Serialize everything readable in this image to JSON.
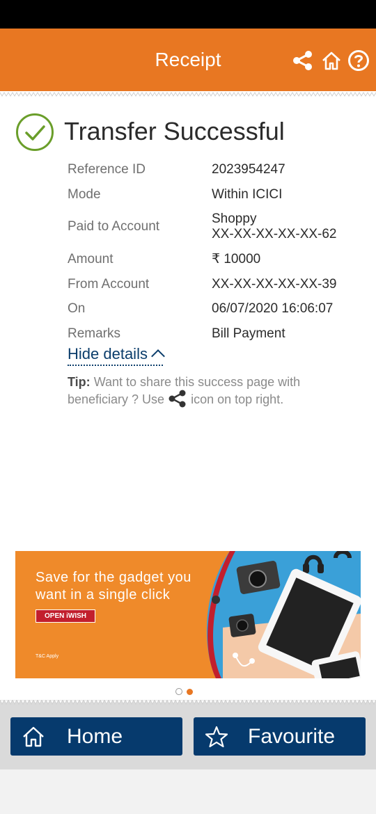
{
  "header": {
    "title": "Receipt"
  },
  "receipt": {
    "status_title": "Transfer Successful",
    "details": [
      {
        "label": "Reference ID",
        "value": "2023954247"
      },
      {
        "label": "Mode",
        "value": "Within ICICI"
      },
      {
        "label": "Paid to Account",
        "value_line1": "Shoppy",
        "value_line2": "XX-XX-XX-XX-XX-62"
      },
      {
        "label": "Amount",
        "value": "₹ 10000"
      },
      {
        "label": "From Account",
        "value": "XX-XX-XX-XX-XX-39"
      },
      {
        "label": "On",
        "value": "06/07/2020 16:06:07"
      },
      {
        "label": "Remarks",
        "value": "Bill Payment"
      }
    ],
    "hide_details_label": "Hide details",
    "tip_label": "Tip:",
    "tip_text_1": "Want to share this success page with beneficiary ? Use",
    "tip_text_2": "icon on top right."
  },
  "banner": {
    "text": "Save for the gadget you want in a single click",
    "button_label": "OPEN iWISH",
    "small_print": "T&C Apply",
    "total_slides": 2,
    "active_slide": 2
  },
  "footer": {
    "home_label": "Home",
    "favourite_label": "Favourite"
  },
  "colors": {
    "brand_orange": "#e87722",
    "success_green": "#6a9e2a",
    "nav_blue": "#063a6d"
  }
}
